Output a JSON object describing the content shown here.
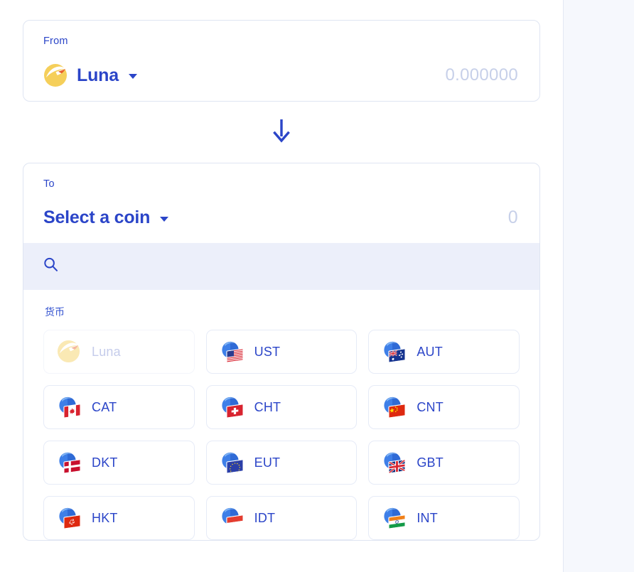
{
  "app": {
    "background_color": "#f6f8fd",
    "accent_color": "#2b45c8",
    "panel_color": "#ffffff",
    "search_band_color": "#eceffa",
    "border_color": "#dfe5f2",
    "muted_text_color": "#c7d0e9"
  },
  "from_card": {
    "label": "From",
    "coin_name": "Luna",
    "coin_icon": "luna-icon",
    "dropdown_icon": "chevron-down-icon",
    "amount_value": "",
    "amount_placeholder": "0.000000"
  },
  "swap_arrow": {
    "icon": "arrow-down-icon",
    "color": "#2b45c8"
  },
  "to_card": {
    "label": "To",
    "coin_name": "Select a coin",
    "dropdown_icon": "chevron-down-icon",
    "amount_value": "",
    "amount_placeholder": "0"
  },
  "search": {
    "icon": "search-icon",
    "value": "",
    "placeholder": ""
  },
  "coin_list": {
    "group_title": "货币",
    "coins": [
      {
        "code": "Luna",
        "icon": "luna-icon",
        "flag": "luna",
        "disabled": true
      },
      {
        "code": "UST",
        "icon": "globe-flag-icon",
        "flag": "us",
        "disabled": false
      },
      {
        "code": "AUT",
        "icon": "globe-flag-icon",
        "flag": "au",
        "disabled": false
      },
      {
        "code": "CAT",
        "icon": "globe-flag-icon",
        "flag": "ca",
        "disabled": false
      },
      {
        "code": "CHT",
        "icon": "globe-flag-icon",
        "flag": "ch",
        "disabled": false
      },
      {
        "code": "CNT",
        "icon": "globe-flag-icon",
        "flag": "cn",
        "disabled": false
      },
      {
        "code": "DKT",
        "icon": "globe-flag-icon",
        "flag": "dk",
        "disabled": false
      },
      {
        "code": "EUT",
        "icon": "globe-flag-icon",
        "flag": "eu",
        "disabled": false
      },
      {
        "code": "GBT",
        "icon": "globe-flag-icon",
        "flag": "gb",
        "disabled": false
      },
      {
        "code": "HKT",
        "icon": "globe-flag-icon",
        "flag": "hk",
        "disabled": false
      },
      {
        "code": "IDT",
        "icon": "globe-flag-icon",
        "flag": "id",
        "disabled": false
      },
      {
        "code": "INT",
        "icon": "globe-flag-icon",
        "flag": "in",
        "disabled": false
      }
    ]
  }
}
